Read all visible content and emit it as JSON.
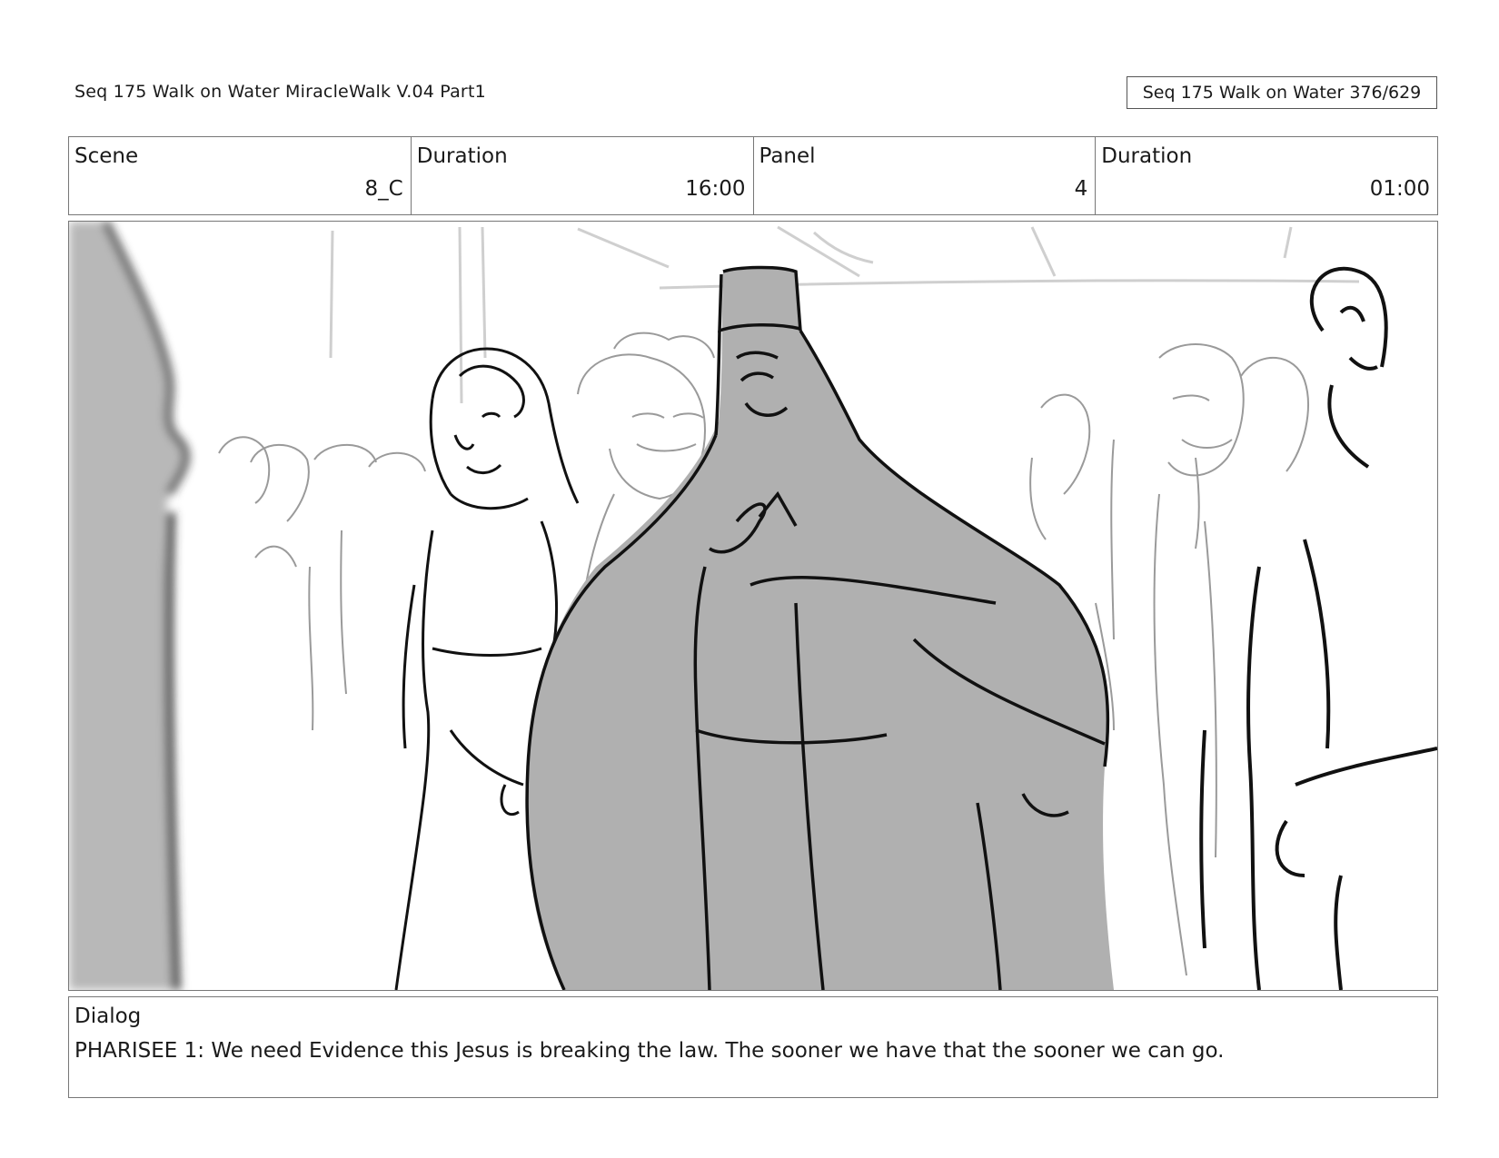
{
  "header": {
    "title": "Seq 175 Walk on Water  MiracleWalk V.04 Part1",
    "page_ref": "Seq 175 Walk on Water 376/629"
  },
  "info": {
    "scene_label": "Scene",
    "scene_value": "8_C",
    "duration_label": "Duration",
    "duration_value": "16:00",
    "panel_label": "Panel",
    "panel_value": "4",
    "panel_duration_label": "Duration",
    "panel_duration_value": "01:00"
  },
  "panel": {
    "icon": "storyboard-sketch"
  },
  "dialog": {
    "label": "Dialog",
    "text": "PHARISEE 1: We need Evidence this Jesus is breaking the law. The sooner we have that the sooner we can go."
  }
}
